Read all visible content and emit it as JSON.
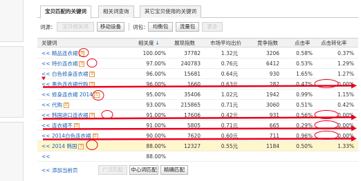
{
  "tabs": [
    {
      "label": "宝贝匹配的关键词",
      "active": true
    },
    {
      "label": "相关词查询",
      "active": false
    },
    {
      "label": "其它宝贝使用的关键词",
      "active": false
    }
  ],
  "source_bar": {
    "label": "词源：",
    "btn_disabled_1": "宝贝相关词",
    "btn_add_device": "移动设备",
    "package_label": "词包：",
    "btn_balanced": "均衡包",
    "btn_traffic": "流量包",
    "btn_disabled_2": "更多"
  },
  "table": {
    "headers": {
      "keyword": "关键词",
      "relevance": "相关度",
      "impressions": "展现指数",
      "avg_bid": "市场平均出价",
      "competition": "竞争指数",
      "ctr": "点击率",
      "cvr": "点击转化率"
    },
    "sort_icon": "arrow-down-icon",
    "badge_text": "☰",
    "rows": [
      {
        "arrow": "<<",
        "keyword": "精品连衣裙",
        "relevance": "100.00%",
        "impressions": "37782",
        "avg_bid": "1.32元",
        "competition": "3206",
        "ctr": "0.58%",
        "cvr": "0.37%"
      },
      {
        "arrow": "<<",
        "keyword": "特价连衣裙",
        "relevance": "97.00%",
        "impressions": "240783",
        "avg_bid": "0.76元",
        "competition": "6412",
        "ctr": "0.53%",
        "cvr": "1.29%"
      },
      {
        "arrow": "<<",
        "keyword": "白色修身连衣裙",
        "relevance": "96.00%",
        "impressions": "15681",
        "avg_bid": "0.64元",
        "competition": "930",
        "ctr": "1.65%",
        "cvr": "1.27%"
      },
      {
        "arrow": "<<",
        "keyword": "黑色连衣裙代购",
        "relevance": "96.00%",
        "impressions": "1660",
        "avg_bid": "0.63元",
        "competition": "282",
        "ctr": "0.47%",
        "cvr": "0.00%"
      },
      {
        "arrow": "<<",
        "keyword": "修身连衣裙 2014",
        "relevance": "95.00%",
        "impressions": "35406",
        "avg_bid": "1.02元",
        "competition": "1942",
        "ctr": "0.99%",
        "cvr": "1.15%"
      },
      {
        "arrow": "<<",
        "keyword": "代购",
        "relevance": "93.00%",
        "impressions": "215865",
        "avg_bid": "0.71元",
        "competition": "3060",
        "ctr": "0.51%",
        "cvr": "0.42%"
      },
      {
        "arrow": "<<",
        "keyword": "韩国进口连衣裙",
        "relevance": "91.00%",
        "impressions": "17606",
        "avg_bid": "0.42元",
        "competition": "931",
        "ctr": "0.56%",
        "cvr": "0.00%"
      },
      {
        "arrow": "<<",
        "keyword": "连衣裙不",
        "relevance": "91.00%",
        "impressions": "5805",
        "avg_bid": "0.71元",
        "competition": "665",
        "ctr": "0.29%",
        "cvr": "0.00%"
      },
      {
        "arrow": "<<",
        "keyword": "2014白色连衣裙",
        "relevance": "90.00%",
        "impressions": "7620",
        "avg_bid": "0.60元",
        "competition": "711",
        "ctr": "0.96%",
        "cvr": "0.00%"
      },
      {
        "arrow": "<<",
        "keyword": "2014 韩国",
        "relevance": "88.00%",
        "impressions": "12327",
        "avg_bid": "0.55元",
        "competition": "1184",
        "ctr": "0.50%",
        "cvr": "1.33%"
      },
      {
        "arrow": "<<",
        "keyword": "",
        "relevance": "88.00%",
        "impressions": "",
        "avg_bid": "",
        "competition": "",
        "ctr": "",
        "cvr": ""
      }
    ]
  },
  "footer": {
    "add_current_page": "<< 添加当前页",
    "btn_disabled": "广泛匹配",
    "btn_center": "中心词匹配",
    "btn_exact": "精确匹配"
  },
  "annotations": {
    "ink_color": "#e8001c"
  }
}
